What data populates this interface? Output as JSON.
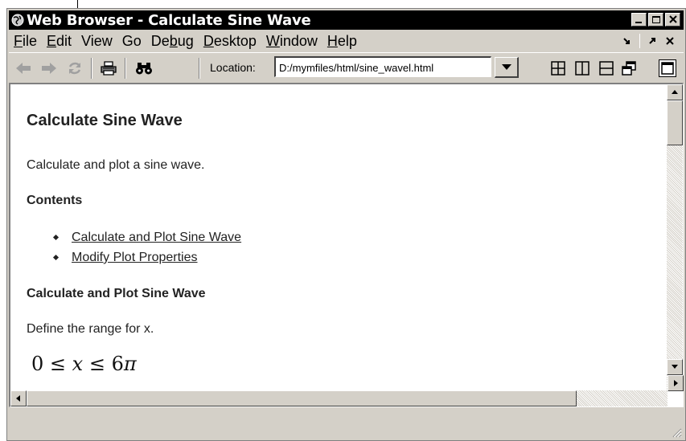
{
  "window": {
    "title": "Web Browser - Calculate Sine Wave",
    "icon": "globe-icon"
  },
  "window_controls": [
    "minimize-icon",
    "maximize-icon",
    "close-icon"
  ],
  "menu": {
    "items": [
      {
        "label": "File",
        "mnemonic": "F",
        "rest": "ile"
      },
      {
        "label": "Edit",
        "mnemonic": "E",
        "rest": "dit"
      },
      {
        "label": "View",
        "mnemonic": "",
        "rest": "View"
      },
      {
        "label": "Go",
        "mnemonic": "",
        "rest": "Go"
      },
      {
        "label": "Debug",
        "pre": "De",
        "mnemonic": "b",
        "rest": "ug"
      },
      {
        "label": "Desktop",
        "mnemonic": "D",
        "rest": "esktop"
      },
      {
        "label": "Window",
        "mnemonic": "W",
        "rest": "indow"
      },
      {
        "label": "Help",
        "mnemonic": "H",
        "rest": "elp"
      }
    ],
    "dock_icon": "dock-arrow-icon",
    "undock_icon": "undock-arrow-icon",
    "close_icon": "close-icon"
  },
  "toolbar": {
    "back_icon": "back-arrow-icon",
    "forward_icon": "forward-arrow-icon",
    "refresh_icon": "refresh-icon",
    "print_icon": "printer-icon",
    "find_icon": "binoculars-icon",
    "location_label": "Location:",
    "location_value": "D:/mymfiles/html/sine_wavel.html",
    "layout_icons": [
      "tile-grid-icon",
      "tile-columns-icon",
      "tile-rows-icon",
      "float-icon",
      "maximize-panel-icon"
    ]
  },
  "content": {
    "title": "Calculate Sine Wave",
    "intro": "Calculate and plot a sine wave.",
    "contents_heading": "Contents",
    "contents_links": [
      "Calculate and Plot Sine Wave",
      "Modify Plot Properties"
    ],
    "section_heading": "Calculate and Plot Sine Wave",
    "section_text": "Define the range for x.",
    "equation": {
      "a": "0",
      "le1": "≤",
      "x": "x",
      "le2": "≤",
      "six": "6",
      "pi": "π"
    }
  },
  "status": {
    "text": ""
  },
  "colors": {
    "chrome": "#d4d0c8",
    "titlebar": "#000000",
    "text": "#222222"
  }
}
